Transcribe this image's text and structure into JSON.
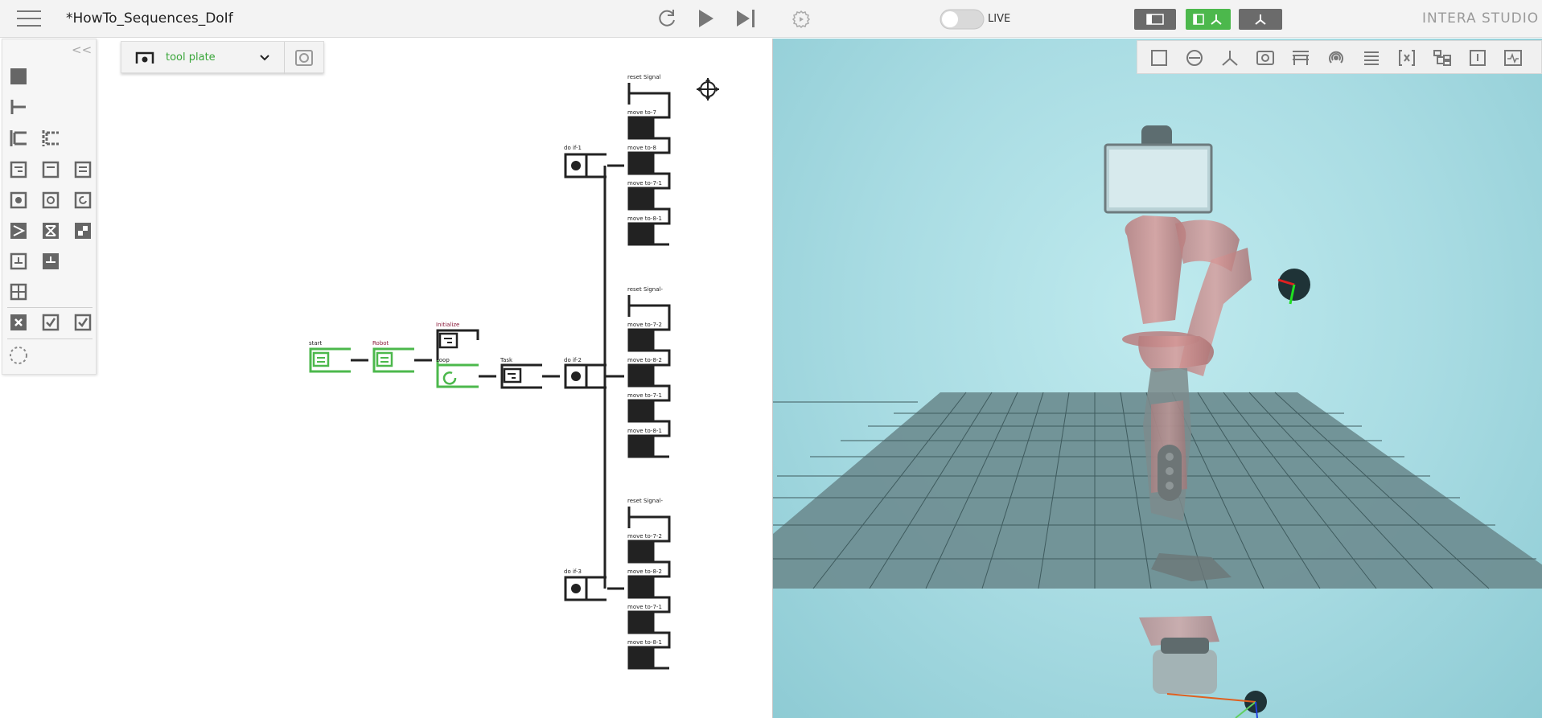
{
  "header": {
    "title": "*HowTo_Sequences_DoIf",
    "live_label": "LIVE",
    "brand": "INTERA STUDIO"
  },
  "frame_selector": {
    "label": "tool plate"
  },
  "toolbox": {
    "collapse_label": "<<"
  },
  "behavior_tree": {
    "nodes": [
      {
        "id": "start",
        "label": "start"
      },
      {
        "id": "robot",
        "label": "Robot"
      },
      {
        "id": "initialize",
        "label": "Initialize"
      },
      {
        "id": "loop",
        "label": "Loop"
      },
      {
        "id": "task",
        "label": "Task"
      },
      {
        "id": "do-if-1",
        "label": "do if-1"
      },
      {
        "id": "do-if-2",
        "label": "do if-2"
      },
      {
        "id": "do-if-3",
        "label": "do if-3"
      },
      {
        "id": "reset-signal-1",
        "label": "reset Signal"
      },
      {
        "id": "reset-signal-2",
        "label": "reset Signal-"
      },
      {
        "id": "reset-signal-3",
        "label": "reset Signal-"
      },
      {
        "id": "g1-move-7",
        "label": "move to-7"
      },
      {
        "id": "g1-move-8",
        "label": "move to-8"
      },
      {
        "id": "g1-move-7-1",
        "label": "move to-7-1"
      },
      {
        "id": "g1-move-8-1",
        "label": "move to-8-1"
      },
      {
        "id": "g2-move-7-2",
        "label": "move to-7-2"
      },
      {
        "id": "g2-move-8-2",
        "label": "move to-8-2"
      },
      {
        "id": "g2-move-7-1",
        "label": "move to-7-1"
      },
      {
        "id": "g2-move-8-1",
        "label": "move to-8-1"
      },
      {
        "id": "g3-move-7-2",
        "label": "move to-7-2"
      },
      {
        "id": "g3-move-8-2",
        "label": "move to-8-2"
      },
      {
        "id": "g3-move-7-1",
        "label": "move to-7-1"
      },
      {
        "id": "g3-move-8-1",
        "label": "move to-8-1"
      }
    ]
  },
  "colors": {
    "accent_green": "#4cb84c",
    "toolbar_dark": "#6b6b6b",
    "node_black": "#222222",
    "viewport_bg": "#a9dce3",
    "floor": "#6f8f93"
  }
}
